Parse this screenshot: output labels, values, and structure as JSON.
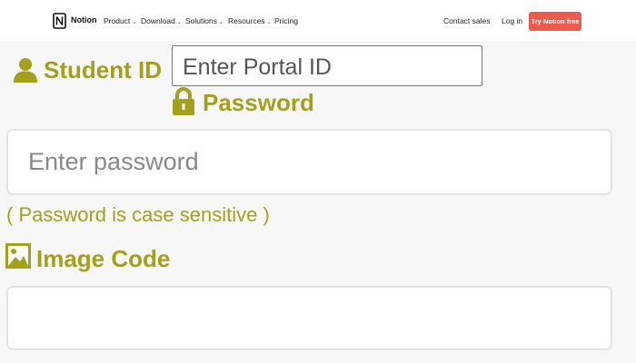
{
  "nav": {
    "brand": "Notion",
    "items": [
      {
        "label": "Product",
        "chevron": true
      },
      {
        "label": "Download",
        "chevron": true
      },
      {
        "label": "Solutions",
        "chevron": true
      },
      {
        "label": "Resources",
        "chevron": true
      },
      {
        "label": "Pricing",
        "chevron": false
      }
    ],
    "contact_sales": "Contact sales",
    "log_in": "Log in",
    "cta": "Try Notion free"
  },
  "form": {
    "student_id_label": "Student ID",
    "portal_placeholder": "Enter Portal ID",
    "password_label": "Password",
    "password_placeholder": "Enter password",
    "password_hint": "( Password is case sensitive )",
    "image_code_label": "Image Code",
    "image_code_value": ""
  },
  "colors": {
    "label": "#a3a11a",
    "cta_bg": "#ef5a4e"
  },
  "icons": {
    "logo": "notion-logo",
    "student_id": "user-icon",
    "password": "lock-icon",
    "image_code": "image-icon"
  }
}
